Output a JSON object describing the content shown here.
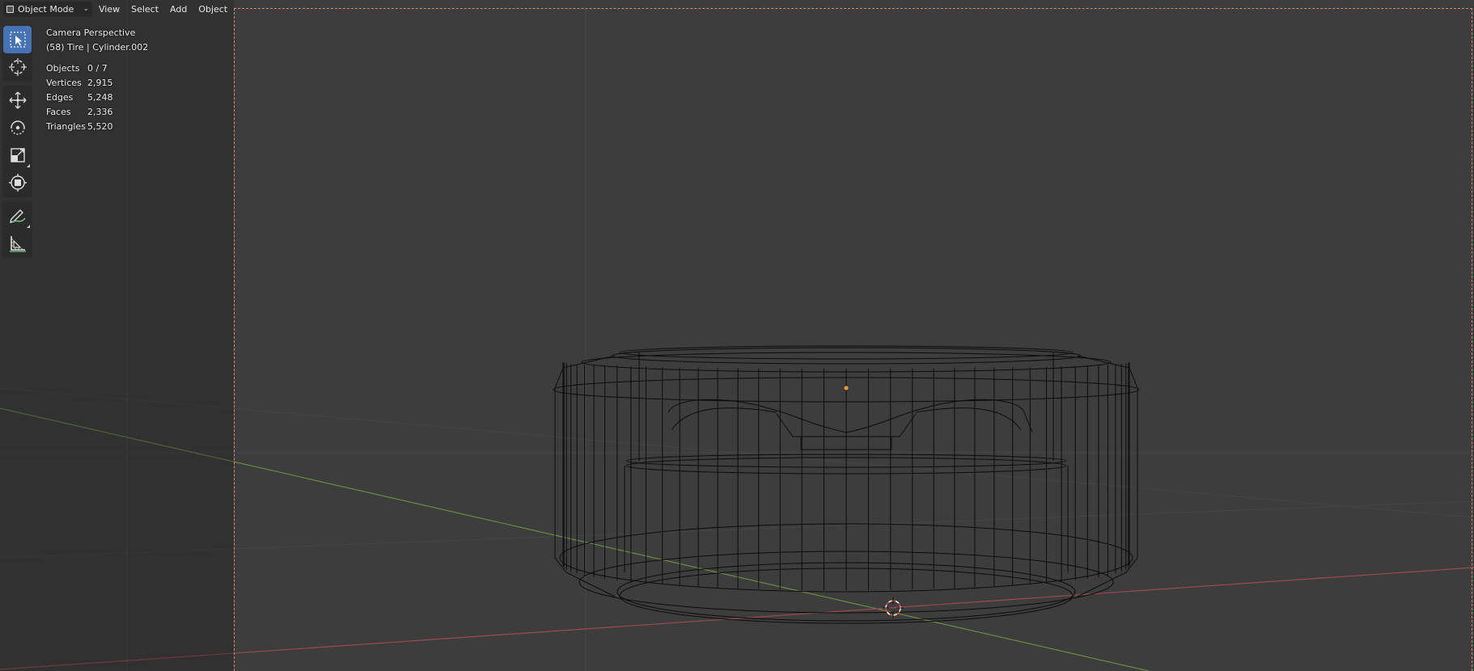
{
  "header": {
    "mode_label": "Object Mode",
    "menus": [
      "View",
      "Select",
      "Add",
      "Object"
    ]
  },
  "overlay": {
    "view_name": "Camera Perspective",
    "active_object": "(58) Tire | Cylinder.002",
    "stats": [
      {
        "label": "Objects",
        "value": "0 / 7"
      },
      {
        "label": "Vertices",
        "value": "2,915"
      },
      {
        "label": "Edges",
        "value": "5,248"
      },
      {
        "label": "Faces",
        "value": "2,336"
      },
      {
        "label": "Triangles",
        "value": "5,520"
      }
    ]
  },
  "toolbar": {
    "tools": [
      "select-box",
      "cursor",
      "move",
      "rotate",
      "scale",
      "transform",
      "annotate",
      "measure"
    ],
    "active_tool": "select-box"
  },
  "colors": {
    "viewport_bg": "#3d3d3d",
    "active_tool": "#4772b3",
    "x_axis": "#9a4b55",
    "y_axis": "#6e8a45",
    "camera_frame": "#d98a70",
    "wire": "#0c0c0c"
  }
}
